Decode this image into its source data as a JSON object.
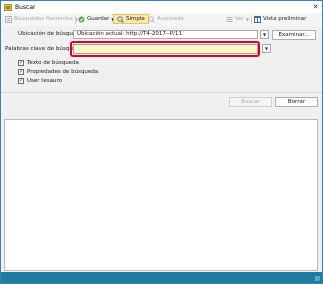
{
  "window": {
    "title": "Buscar",
    "close_symbol": "✕"
  },
  "toolbar": {
    "recent_label": "Búsquedas Recientes",
    "save_label": "Guardar",
    "simple_label": "Simple",
    "advanced_label": "Avanzada",
    "view_label": "Ver",
    "preview_label": "Vista preliminar"
  },
  "form": {
    "location_label": "Ubicación de búsqueda",
    "location_value": "Ubicación actual: http://T4-2017--P/11",
    "browse_label": "Examinar...",
    "keywords_label": "Palabras clave de búsqueda",
    "keywords_value": "",
    "checkboxes": [
      {
        "label": "Texto de búsqueda",
        "checked": true
      },
      {
        "label": "Propiedades de búsqueda",
        "checked": true
      },
      {
        "label": "User tesauro",
        "checked": true
      }
    ],
    "search_button": "Buscar",
    "clear_button": "Borrar"
  },
  "colors": {
    "highlight": "#e0001b",
    "statusbar": "#1f7b9f",
    "keyword_field": "#fff5bf"
  }
}
